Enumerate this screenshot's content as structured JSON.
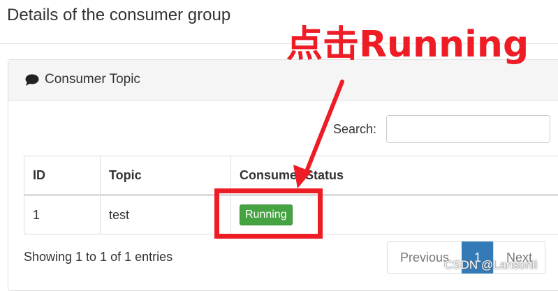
{
  "header": {
    "title": "Details of the consumer group"
  },
  "panel": {
    "title": "Consumer Topic",
    "icon": "comment-icon"
  },
  "search": {
    "label": "Search:",
    "value": ""
  },
  "table": {
    "columns": [
      "ID",
      "Topic",
      "Consumer Status"
    ],
    "rows": [
      {
        "id": "1",
        "topic": "test",
        "status": "Running"
      }
    ]
  },
  "footer": {
    "info": "Showing 1 to 1 of 1 entries",
    "pagination": {
      "previous": "Previous",
      "current": "1",
      "next": "Next"
    }
  },
  "annotation": {
    "text": "点击Running",
    "color": "#ee1c25"
  },
  "watermark": "CSDN @Lansonli",
  "colors": {
    "status_running": "#45a342",
    "page_active": "#337ab7"
  }
}
